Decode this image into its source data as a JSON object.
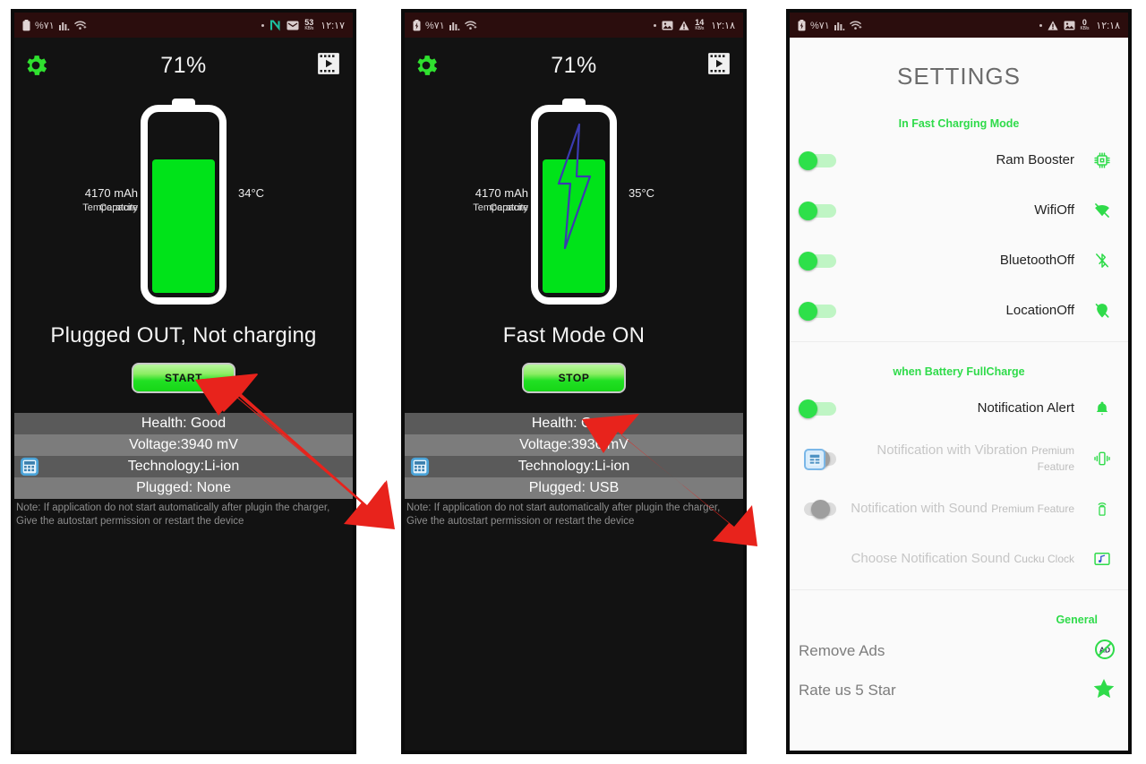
{
  "panels": {
    "p1": {
      "statusbar": {
        "battery_pct": "%٧١",
        "time": "١٢:١٧",
        "kbs_value": "53",
        "kbs_unit": "KB/s",
        "icons_left": [
          "battery-icon",
          "signal-bars-icon",
          "wifi-icon"
        ],
        "icons_right": [
          "dot-icon",
          "n-app-icon",
          "mail-icon",
          "data-speed-icon"
        ]
      },
      "percent": "71%",
      "gear_icon": "gear-icon",
      "video_icon": "video-icon",
      "capacity_value": "4170 mAh",
      "capacity_label": "Capacity",
      "temp_value": "34°C",
      "temp_label": "Temperature",
      "status_text": "Plugged OUT, Not charging",
      "action_label": "START",
      "charging": false,
      "fill_percent": 72,
      "info_rows": [
        "Health: Good",
        "Voltage:3940 mV",
        "Technology:Li-ion",
        "Plugged: None"
      ],
      "note": "Note: If application do not start automatically after plugin the charger, Give the autostart permission or restart the device"
    },
    "p2": {
      "statusbar": {
        "battery_pct": "%٧١",
        "time": "١٢:١٨",
        "kbs_value": "14",
        "kbs_unit": "KB/s",
        "icons_left": [
          "battery-charging-icon",
          "signal-bars-icon",
          "wifi-icon"
        ],
        "icons_right": [
          "dot-icon",
          "image-icon",
          "warning-icon",
          "data-speed-icon"
        ]
      },
      "percent": "71%",
      "gear_icon": "gear-icon",
      "video_icon": "video-icon",
      "capacity_value": "4170 mAh",
      "capacity_label": "Capacity",
      "temp_value": "35°C",
      "temp_label": "Temperature",
      "status_text": "Fast Mode ON",
      "action_label": "STOP",
      "charging": true,
      "fill_percent": 72,
      "info_rows": [
        "Health: Good",
        "Voltage:3936 mV",
        "Technology:Li-ion",
        "Plugged: USB"
      ],
      "note": "Note: If application do not start automatically after plugin the charger, Give the autostart permission or restart the device"
    },
    "p3": {
      "statusbar": {
        "battery_pct": "%٧١",
        "time": "١٢:١٨",
        "kbs_value": "0",
        "kbs_unit": "KB/s",
        "icons_left": [
          "battery-charging-icon",
          "signal-bars-icon",
          "wifi-icon"
        ],
        "icons_right": [
          "dot-icon",
          "warning-icon",
          "image-icon",
          "data-speed-icon"
        ]
      },
      "title": "SETTINGS",
      "sections": [
        {
          "heading": "In Fast Charging Mode",
          "rows": [
            {
              "label": "Ram Booster",
              "sub": "",
              "toggle": "on",
              "icon": "cpu-icon",
              "locked": false,
              "dim": false
            },
            {
              "label": "WifiOff",
              "sub": "",
              "toggle": "on",
              "icon": "wifi-off-icon",
              "locked": false,
              "dim": false
            },
            {
              "label": "BluetoothOff",
              "sub": "",
              "toggle": "on",
              "icon": "bluetooth-off-icon",
              "locked": false,
              "dim": false
            },
            {
              "label": "LocationOff",
              "sub": "",
              "toggle": "on",
              "icon": "location-off-icon",
              "locked": false,
              "dim": false
            }
          ]
        },
        {
          "heading": "when Battery FullCharge",
          "rows": [
            {
              "label": "Notification Alert",
              "sub": "",
              "toggle": "on",
              "icon": "bell-icon",
              "locked": false,
              "dim": false
            },
            {
              "label": "Notification with Vibration",
              "sub": "Premium Feature",
              "toggle": "off",
              "icon": "vibration-icon",
              "locked": true,
              "dim": true
            },
            {
              "label": "Notification with Sound",
              "sub": "Premium Feature",
              "toggle": "off",
              "icon": "sound-icon",
              "locked": false,
              "dim": true
            },
            {
              "label": "Choose Notification Sound",
              "sub": "Cucku Clock",
              "toggle": "none",
              "icon": "music-note-icon",
              "locked": false,
              "dim": true
            }
          ]
        },
        {
          "heading": "General",
          "rows": [
            {
              "label": "Remove Ads",
              "sub": "",
              "toggle": "none",
              "icon": "no-ads-icon",
              "locked": false,
              "dim": true,
              "general": true
            },
            {
              "label": "Rate us 5 Star",
              "sub": "",
              "toggle": "none",
              "icon": "star-icon",
              "locked": false,
              "dim": true,
              "general": true
            }
          ]
        }
      ]
    }
  },
  "annotations": {
    "arrow1_name": "red-arrow-pointing-start",
    "arrow2_name": "red-arrow-pointing-stop",
    "arrow_color": "#e8231c"
  },
  "colors": {
    "green": "#00e319",
    "accent_green": "#2fdb4a",
    "statusbar_bg": "#2b0d0d",
    "screen_bg": "#121212",
    "settings_bg": "#fafafa"
  }
}
